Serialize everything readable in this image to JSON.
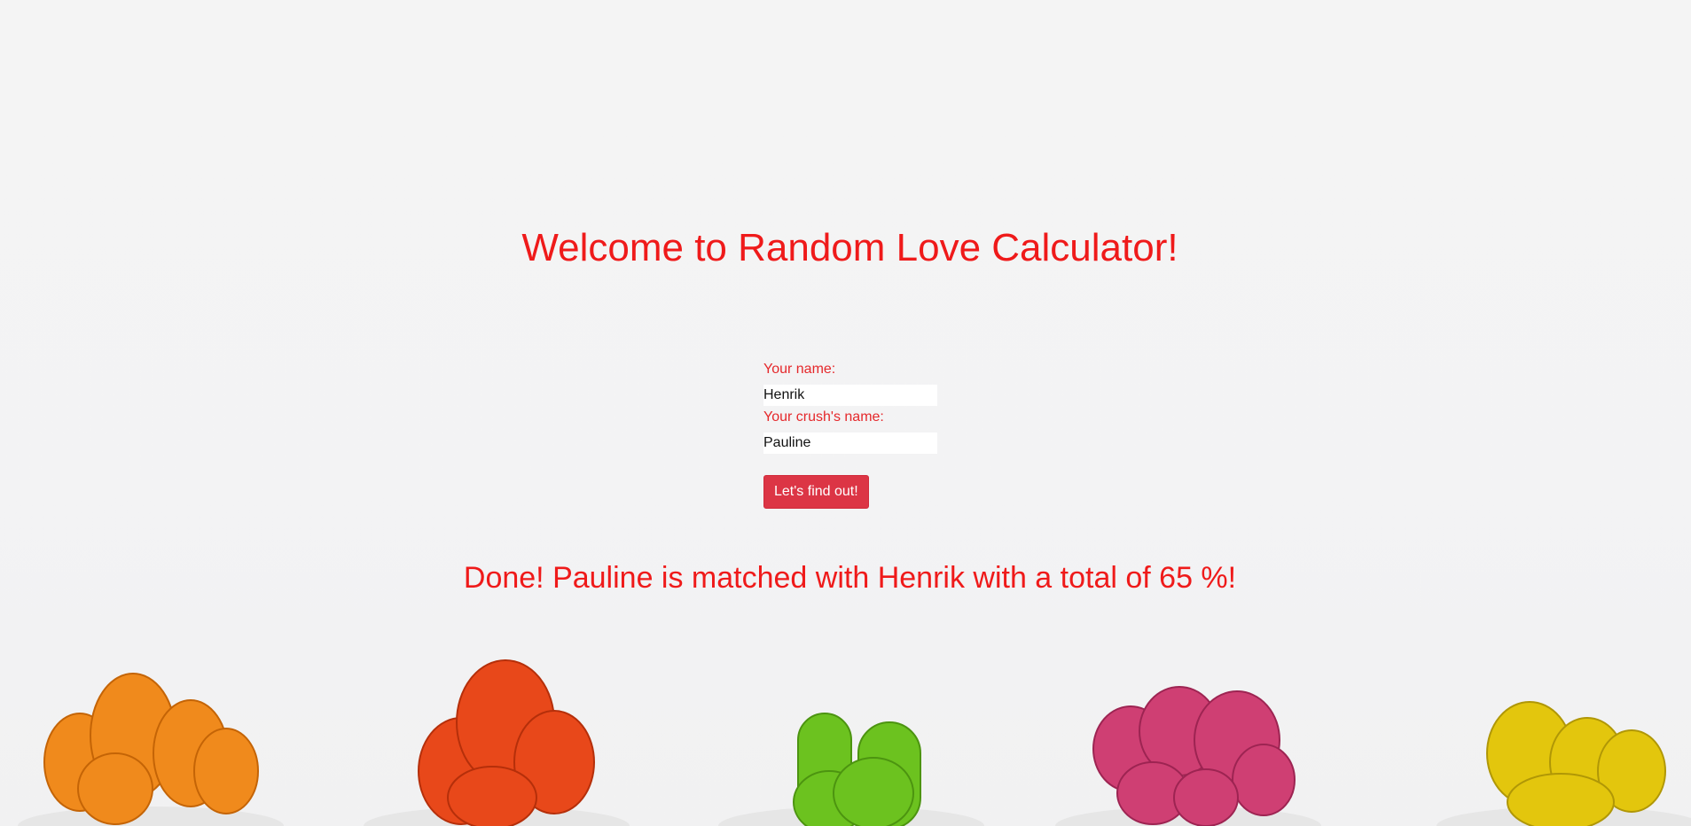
{
  "header": {
    "title": "Welcome to Random Love Calculator!"
  },
  "form": {
    "your_name_label": "Your name:",
    "your_name_value": "Henrik",
    "crush_name_label": "Your crush's name:",
    "crush_name_value": "Pauline",
    "submit_label": "Let's find out!"
  },
  "result": {
    "text": "Done! Pauline is matched with Henrik with a total of 65 %!"
  },
  "colors": {
    "accent_text": "#ef1a1a",
    "button_bg": "#dc3545",
    "background": "#f4f4f4"
  },
  "decor": {
    "plants": [
      {
        "icon": "cactus-orange-icon",
        "color": "#f08a1c"
      },
      {
        "icon": "cactus-red-icon",
        "color": "#e8481a"
      },
      {
        "icon": "cactus-green-icon",
        "color": "#6cc21f"
      },
      {
        "icon": "cactus-pink-icon",
        "color": "#cf3f73"
      },
      {
        "icon": "cactus-yellow-icon",
        "color": "#e3c60d"
      }
    ]
  }
}
